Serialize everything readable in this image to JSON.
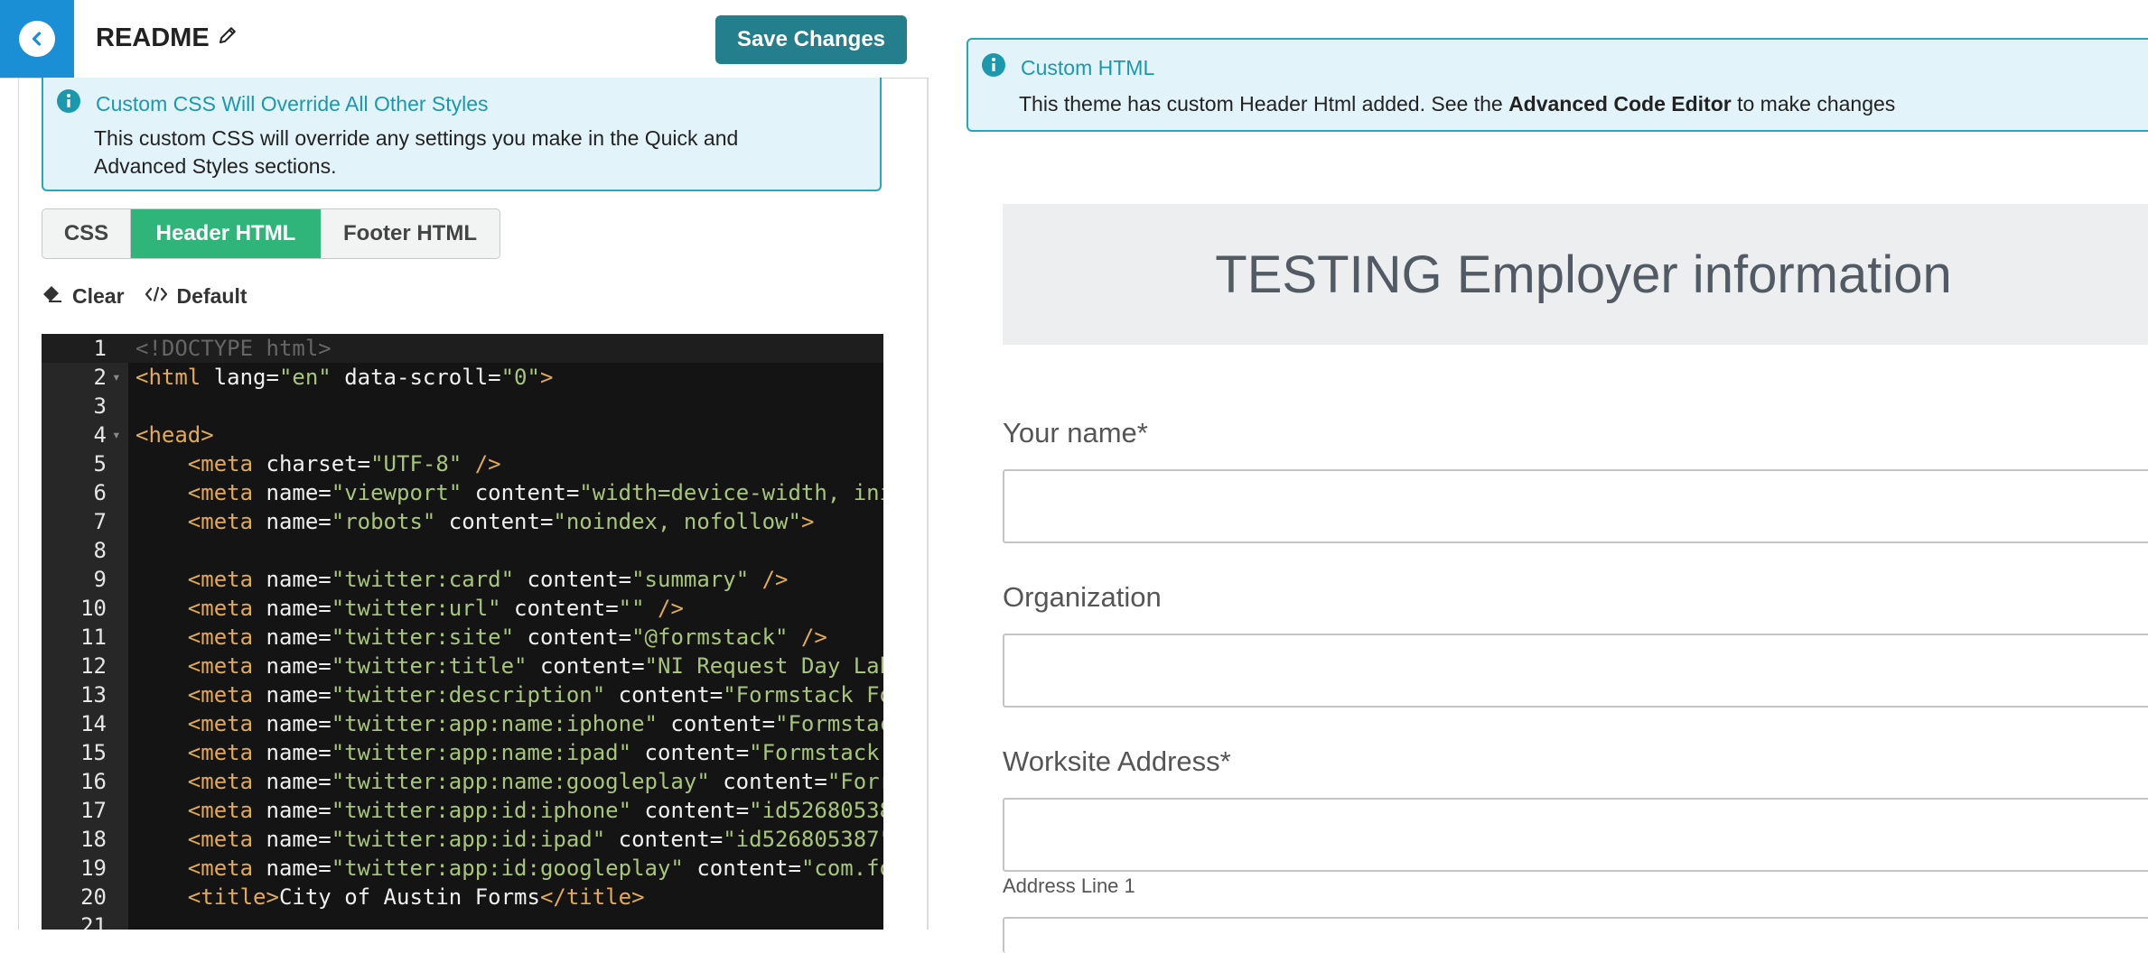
{
  "topbar": {
    "title": "README",
    "save_label": "Save Changes"
  },
  "left_alert": {
    "heading": "Custom CSS Will Override All Other Styles",
    "body_line1": "This custom CSS will override any settings you make in the Quick and",
    "body_line2": "Advanced Styles sections."
  },
  "tabs": [
    {
      "label": "CSS",
      "active": false
    },
    {
      "label": "Header HTML",
      "active": true
    },
    {
      "label": "Footer HTML",
      "active": false
    }
  ],
  "tools": {
    "clear_label": "Clear",
    "default_label": "Default"
  },
  "editor": {
    "lines": [
      {
        "n": "1",
        "fold": false,
        "tokens": [
          [
            "doctype",
            "<!DOCTYPE html>"
          ]
        ]
      },
      {
        "n": "2",
        "fold": true,
        "tokens": [
          [
            "tag",
            "<html"
          ],
          [
            "attr",
            " lang="
          ],
          [
            "str",
            "\"en\""
          ],
          [
            "attr",
            " data-scroll="
          ],
          [
            "str",
            "\"0\""
          ],
          [
            "tag",
            ">"
          ]
        ]
      },
      {
        "n": "3",
        "fold": false,
        "tokens": []
      },
      {
        "n": "4",
        "fold": true,
        "tokens": [
          [
            "tag",
            "<head>"
          ]
        ]
      },
      {
        "n": "5",
        "fold": false,
        "tokens": [
          [
            "text",
            "    "
          ],
          [
            "tag",
            "<meta"
          ],
          [
            "attr",
            " charset="
          ],
          [
            "str",
            "\"UTF-8\""
          ],
          [
            "tag",
            " />"
          ]
        ]
      },
      {
        "n": "6",
        "fold": false,
        "tokens": [
          [
            "text",
            "    "
          ],
          [
            "tag",
            "<meta"
          ],
          [
            "attr",
            " name="
          ],
          [
            "str",
            "\"viewport\""
          ],
          [
            "attr",
            " content="
          ],
          [
            "str",
            "\"width=device-width, ini"
          ]
        ]
      },
      {
        "n": "7",
        "fold": false,
        "tokens": [
          [
            "text",
            "    "
          ],
          [
            "tag",
            "<meta"
          ],
          [
            "attr",
            " name="
          ],
          [
            "str",
            "\"robots\""
          ],
          [
            "attr",
            " content="
          ],
          [
            "str",
            "\"noindex, nofollow\""
          ],
          [
            "tag",
            ">"
          ]
        ]
      },
      {
        "n": "8",
        "fold": false,
        "tokens": []
      },
      {
        "n": "9",
        "fold": false,
        "tokens": [
          [
            "text",
            "    "
          ],
          [
            "tag",
            "<meta"
          ],
          [
            "attr",
            " name="
          ],
          [
            "str",
            "\"twitter:card\""
          ],
          [
            "attr",
            " content="
          ],
          [
            "str",
            "\"summary\""
          ],
          [
            "tag",
            " />"
          ]
        ]
      },
      {
        "n": "10",
        "fold": false,
        "tokens": [
          [
            "text",
            "    "
          ],
          [
            "tag",
            "<meta"
          ],
          [
            "attr",
            " name="
          ],
          [
            "str",
            "\"twitter:url\""
          ],
          [
            "attr",
            " content="
          ],
          [
            "str",
            "\"\""
          ],
          [
            "tag",
            " />"
          ]
        ]
      },
      {
        "n": "11",
        "fold": false,
        "tokens": [
          [
            "text",
            "    "
          ],
          [
            "tag",
            "<meta"
          ],
          [
            "attr",
            " name="
          ],
          [
            "str",
            "\"twitter:site\""
          ],
          [
            "attr",
            " content="
          ],
          [
            "str",
            "\"@formstack\""
          ],
          [
            "tag",
            " />"
          ]
        ]
      },
      {
        "n": "12",
        "fold": false,
        "tokens": [
          [
            "text",
            "    "
          ],
          [
            "tag",
            "<meta"
          ],
          [
            "attr",
            " name="
          ],
          [
            "str",
            "\"twitter:title\""
          ],
          [
            "attr",
            " content="
          ],
          [
            "str",
            "\"NI Request Day Lab"
          ]
        ]
      },
      {
        "n": "13",
        "fold": false,
        "tokens": [
          [
            "text",
            "    "
          ],
          [
            "tag",
            "<meta"
          ],
          [
            "attr",
            " name="
          ],
          [
            "str",
            "\"twitter:description\""
          ],
          [
            "attr",
            " content="
          ],
          [
            "str",
            "\"Formstack Fo"
          ]
        ]
      },
      {
        "n": "14",
        "fold": false,
        "tokens": [
          [
            "text",
            "    "
          ],
          [
            "tag",
            "<meta"
          ],
          [
            "attr",
            " name="
          ],
          [
            "str",
            "\"twitter:app:name:iphone\""
          ],
          [
            "attr",
            " content="
          ],
          [
            "str",
            "\"Formstac"
          ]
        ]
      },
      {
        "n": "15",
        "fold": false,
        "tokens": [
          [
            "text",
            "    "
          ],
          [
            "tag",
            "<meta"
          ],
          [
            "attr",
            " name="
          ],
          [
            "str",
            "\"twitter:app:name:ipad\""
          ],
          [
            "attr",
            " content="
          ],
          [
            "str",
            "\"Formstack"
          ]
        ]
      },
      {
        "n": "16",
        "fold": false,
        "tokens": [
          [
            "text",
            "    "
          ],
          [
            "tag",
            "<meta"
          ],
          [
            "attr",
            " name="
          ],
          [
            "str",
            "\"twitter:app:name:googleplay\""
          ],
          [
            "attr",
            " content="
          ],
          [
            "str",
            "\"Forr"
          ]
        ]
      },
      {
        "n": "17",
        "fold": false,
        "tokens": [
          [
            "text",
            "    "
          ],
          [
            "tag",
            "<meta"
          ],
          [
            "attr",
            " name="
          ],
          [
            "str",
            "\"twitter:app:id:iphone\""
          ],
          [
            "attr",
            " content="
          ],
          [
            "str",
            "\"id52680538"
          ]
        ]
      },
      {
        "n": "18",
        "fold": false,
        "tokens": [
          [
            "text",
            "    "
          ],
          [
            "tag",
            "<meta"
          ],
          [
            "attr",
            " name="
          ],
          [
            "str",
            "\"twitter:app:id:ipad\""
          ],
          [
            "attr",
            " content="
          ],
          [
            "str",
            "\"id526805387\""
          ]
        ]
      },
      {
        "n": "19",
        "fold": false,
        "tokens": [
          [
            "text",
            "    "
          ],
          [
            "tag",
            "<meta"
          ],
          [
            "attr",
            " name="
          ],
          [
            "str",
            "\"twitter:app:id:googleplay\""
          ],
          [
            "attr",
            " content="
          ],
          [
            "str",
            "\"com.fo"
          ]
        ]
      },
      {
        "n": "20",
        "fold": false,
        "tokens": [
          [
            "text",
            "    "
          ],
          [
            "tag",
            "<title>"
          ],
          [
            "text",
            "City of Austin Forms"
          ],
          [
            "tag",
            "</title>"
          ]
        ]
      },
      {
        "n": "21",
        "fold": false,
        "tokens": []
      }
    ]
  },
  "right_alert": {
    "heading": "Custom HTML",
    "body_prefix": "This theme has custom Header Html added. See the ",
    "body_link": "Advanced Code Editor",
    "body_suffix": " to make changes"
  },
  "form": {
    "title": "TESTING Employer information",
    "fields": [
      {
        "label": "Your name",
        "required": "*"
      },
      {
        "label": "Organization",
        "required": ""
      },
      {
        "label": "Worksite Address",
        "required": "*"
      }
    ],
    "address_sublabel": "Address Line 1"
  },
  "colors": {
    "accent_blue": "#1a8fd6",
    "save_button": "#237f8c",
    "active_tab": "#2fb57a",
    "info_bg": "#e2f4fa",
    "info_border": "#2aa6b8",
    "editor_bg": "#141414"
  }
}
